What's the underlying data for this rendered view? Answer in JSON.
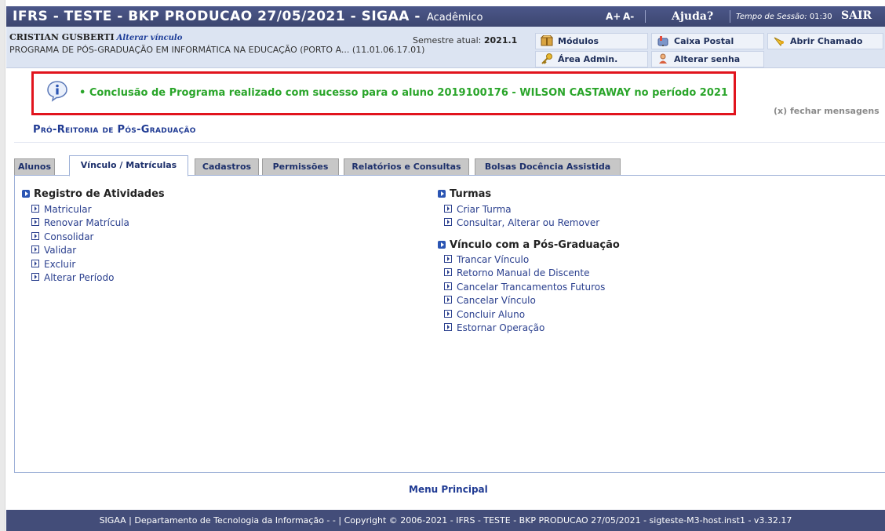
{
  "header": {
    "system_title": "IFRS - TESTE - BKP PRODUCAO 27/05/2021 - SIGAA -",
    "module": "Acadêmico",
    "font_increase": "A+",
    "font_decrease": "A-",
    "help": "Ajuda?",
    "session_label": "Tempo de Sessão:",
    "session_time": "01:30",
    "logout": "SAIR"
  },
  "user": {
    "name": "CRISTIAN GUSBERTI",
    "change_link": "Alterar vínculo",
    "program": "PROGRAMA DE PÓS-GRADUAÇÃO EM INFORMÁTICA NA EDUCAÇÃO (PORTO A... (11.01.06.17.01)",
    "semester_label": "Semestre atual:",
    "semester_value": "2021.1"
  },
  "quick_links": {
    "modulos": "Módulos",
    "area_admin": "Área Admin.",
    "caixa_postal": "Caixa Postal",
    "alterar_senha": "Alterar senha",
    "abrir_chamado": "Abrir Chamado"
  },
  "message": {
    "text": "• Conclusão de Programa realizado com sucesso para o aluno 2019100176 - WILSON CASTAWAY no período 2021",
    "close": "(x) fechar mensagens"
  },
  "section_title": "Pró-Reitoria de Pós-Graduação",
  "tabs": [
    {
      "label": "Alunos",
      "active": false
    },
    {
      "label": "Vínculo / Matrículas",
      "active": true
    },
    {
      "label": "Cadastros",
      "active": false
    },
    {
      "label": "Permissões",
      "active": false
    },
    {
      "label": "Relatórios e Consultas",
      "active": false
    },
    {
      "label": "Bolsas Docência Assistida",
      "active": false
    }
  ],
  "menu": {
    "registro": {
      "title": "Registro de Atividades",
      "items": [
        "Matricular",
        "Renovar Matrícula",
        "Consolidar",
        "Validar",
        "Excluir",
        "Alterar Período"
      ]
    },
    "turmas": {
      "title": "Turmas",
      "items": [
        "Criar Turma",
        "Consultar, Alterar ou Remover"
      ]
    },
    "vinculo": {
      "title": "Vínculo com a Pós-Graduação",
      "items": [
        "Trancar Vínculo",
        "Retorno Manual de Discente",
        "Cancelar Trancamentos Futuros",
        "Cancelar Vínculo",
        "Concluir Aluno",
        "Estornar Operação"
      ]
    }
  },
  "main_menu": "Menu Principal",
  "footer": "SIGAA | Departamento de Tecnologia da Informação - - | Copyright © 2006-2021 - IFRS - TESTE - BKP PRODUCAO 27/05/2021 - sigteste-M3-host.inst1 - v3.32.17",
  "colors": {
    "header_bg": "#434d79",
    "info_bg": "#dce4f2",
    "success_text": "#2aa52a",
    "highlight_border": "#e1141d",
    "link": "#2a3f8e"
  }
}
